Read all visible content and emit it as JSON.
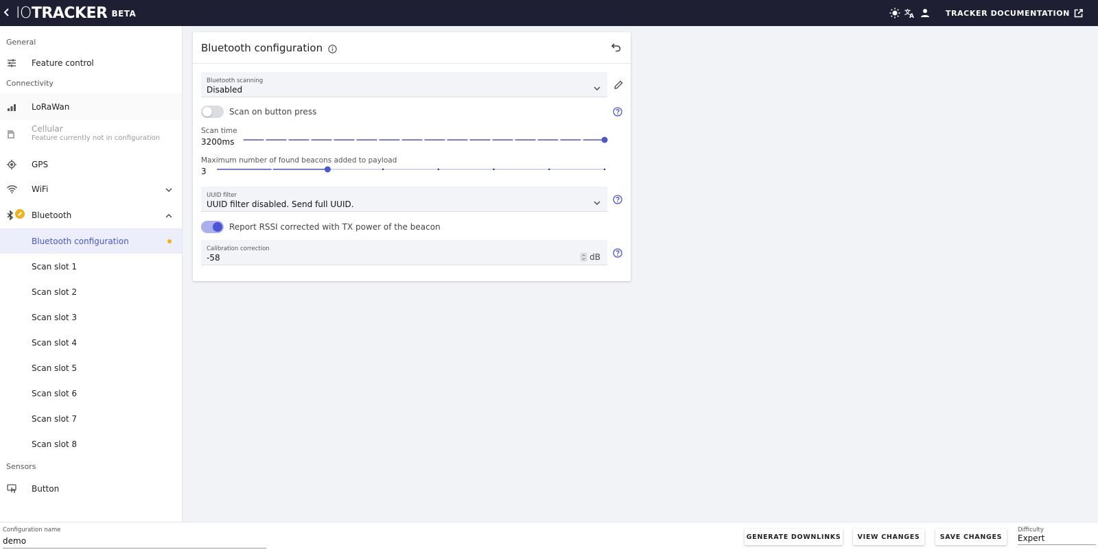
{
  "header": {
    "logo_io": "IO",
    "logo_main": "TRACKER",
    "beta": "BETA",
    "doc_link": "TRACKER DOCUMENTATION",
    "icons": [
      "back-chevron-icon",
      "brightness-icon",
      "translate-icon",
      "account-icon",
      "open-in-new-icon"
    ]
  },
  "sidebar": {
    "sections": {
      "general": "General",
      "connectivity": "Connectivity",
      "sensors": "Sensors"
    },
    "items": {
      "feature_control": "Feature control",
      "lorawan": "LoRaWan",
      "cellular": "Cellular",
      "cellular_sub": "Feature currently not in configuration",
      "gps": "GPS",
      "wifi": "WiFi",
      "bluetooth": "Bluetooth",
      "button": "Button"
    },
    "bluetooth_sub": [
      "Bluetooth configuration",
      "Scan slot 1",
      "Scan slot 2",
      "Scan slot 3",
      "Scan slot 4",
      "Scan slot 5",
      "Scan slot 6",
      "Scan slot 7",
      "Scan slot 8"
    ]
  },
  "card": {
    "title": "Bluetooth configuration",
    "scanning": {
      "label": "Bluetooth scanning",
      "value": "Disabled"
    },
    "scan_on_button": {
      "label": "Scan on button press",
      "enabled": false
    },
    "scan_time": {
      "label": "Scan time",
      "value": "3200ms",
      "level": 1.0,
      "steps": 16
    },
    "max_beacons": {
      "label": "Maximum number of found beacons added to payload",
      "value": "3",
      "level": 0.2857,
      "steps": 7
    },
    "uuid_filter": {
      "label": "UUID filter",
      "value": "UUID filter disabled. Send full UUID."
    },
    "report_rssi": {
      "label": "Report RSSI corrected with TX power of the beacon",
      "enabled": true
    },
    "calibration": {
      "label": "Calibration correction",
      "value": "-58",
      "unit": "dB"
    }
  },
  "footer": {
    "config_name_label": "Configuration name",
    "config_name_value": "demo",
    "generate": "GENERATE DOWNLINKS",
    "view": "VIEW CHANGES",
    "save": "SAVE CHANGES",
    "difficulty_label": "Difficulty",
    "difficulty_value": "Expert"
  },
  "colors": {
    "header_bg": "#1f1f33",
    "accent": "#4a54d4",
    "edit_badge": "#f2b01e",
    "selected_bg": "#eceefb"
  }
}
